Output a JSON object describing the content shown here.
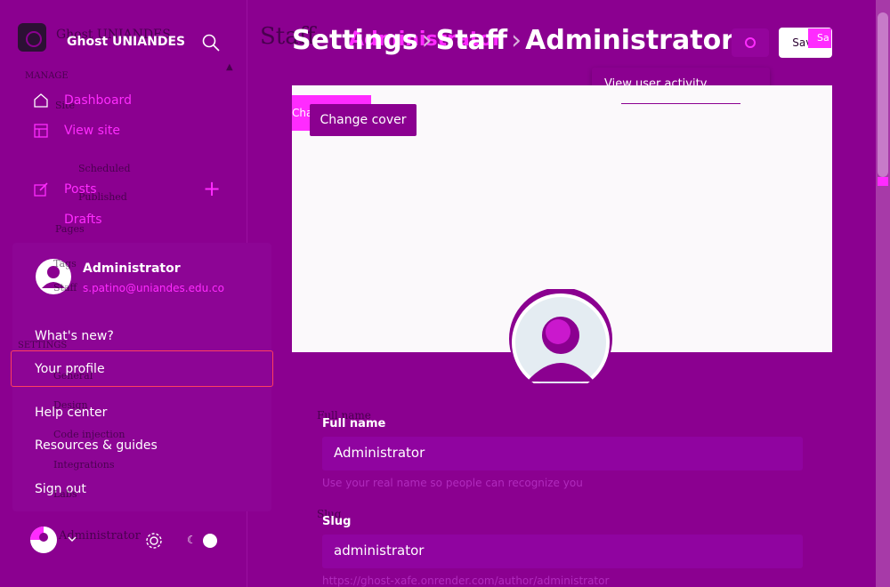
{
  "colors": {
    "background": "#8b0090",
    "accent": "#ff2bff",
    "save_bg": "#ffffff"
  },
  "sidebar": {
    "brand": "Ghost UNIANDES",
    "nav": [
      {
        "label": "Dashboard",
        "icon": "home-icon"
      },
      {
        "label": "View site",
        "icon": "layout-icon"
      },
      {
        "label": "Posts",
        "icon": "pencil-icon"
      },
      {
        "label": "Drafts",
        "icon": ""
      }
    ],
    "ghost_labels": {
      "brand": "Ghost UNIANDES",
      "manage": "MANAGE",
      "site": "Site",
      "scheduled": "Scheduled",
      "published": "Published",
      "pages": "Pages",
      "tags": "Tags",
      "staff": "Staff",
      "settings": "SETTINGS",
      "general": "General",
      "design": "Design",
      "code_injection": "Code injection",
      "integrations": "Integrations",
      "labs": "Labs",
      "user": "Administrator"
    }
  },
  "user_menu": {
    "name": "Administrator",
    "email": "s.patino@uniandes.edu.co",
    "items": [
      "What's new?",
      "Your profile",
      "Help center",
      "Resources & guides",
      "Sign out"
    ]
  },
  "header": {
    "crumbs": [
      "Settings",
      "Staff",
      "Administrator"
    ],
    "ghost_crumbs": [
      "Staff",
      "Administrator"
    ],
    "save_label": "Save",
    "save_ghost": "Sa"
  },
  "dropdown": {
    "item": "View user activity"
  },
  "cover": {
    "change_cover": "Change cover",
    "ghost_button": "Change"
  },
  "form": {
    "full_name": {
      "label": "Full name",
      "ghost_label": "Full name",
      "value": "Administrator",
      "hint": "Use your real name so people can recognize you"
    },
    "slug": {
      "label": "Slug",
      "ghost_label": "Slug",
      "value": "administrator",
      "hint": "https://ghost-xafe.onrender.com/author/administrator"
    }
  }
}
